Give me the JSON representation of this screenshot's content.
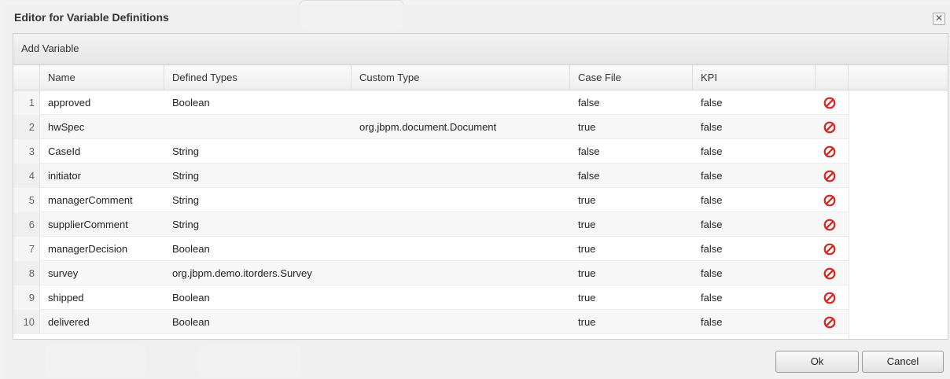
{
  "dialog": {
    "title": "Editor for Variable Definitions",
    "close_glyph": "✕"
  },
  "toolbar": {
    "add_label": "Add Variable"
  },
  "columns": [
    "Name",
    "Defined Types",
    "Custom Type",
    "Case File",
    "KPI"
  ],
  "rows": [
    {
      "num": "1",
      "name": "approved",
      "defined_type": "Boolean",
      "custom_type": "",
      "case_file": "false",
      "kpi": "false"
    },
    {
      "num": "2",
      "name": "hwSpec",
      "defined_type": "",
      "custom_type": "org.jbpm.document.Document",
      "case_file": "true",
      "kpi": "false"
    },
    {
      "num": "3",
      "name": "CaseId",
      "defined_type": "String",
      "custom_type": "",
      "case_file": "false",
      "kpi": "false"
    },
    {
      "num": "4",
      "name": "initiator",
      "defined_type": "String",
      "custom_type": "",
      "case_file": "false",
      "kpi": "false"
    },
    {
      "num": "5",
      "name": "managerComment",
      "defined_type": "String",
      "custom_type": "",
      "case_file": "true",
      "kpi": "false"
    },
    {
      "num": "6",
      "name": "supplierComment",
      "defined_type": "String",
      "custom_type": "",
      "case_file": "true",
      "kpi": "false"
    },
    {
      "num": "7",
      "name": "managerDecision",
      "defined_type": "Boolean",
      "custom_type": "",
      "case_file": "true",
      "kpi": "false"
    },
    {
      "num": "8",
      "name": "survey",
      "defined_type": "org.jbpm.demo.itorders.Survey",
      "custom_type": "",
      "case_file": "true",
      "kpi": "false"
    },
    {
      "num": "9",
      "name": "shipped",
      "defined_type": "Boolean",
      "custom_type": "",
      "case_file": "true",
      "kpi": "false"
    },
    {
      "num": "10",
      "name": "delivered",
      "defined_type": "Boolean",
      "custom_type": "",
      "case_file": "true",
      "kpi": "false"
    }
  ],
  "buttons": {
    "ok": "Ok",
    "cancel": "Cancel"
  },
  "colors": {
    "delete_icon": "#d7261e"
  },
  "icons": {
    "delete": "delete-icon",
    "close": "close-icon"
  }
}
